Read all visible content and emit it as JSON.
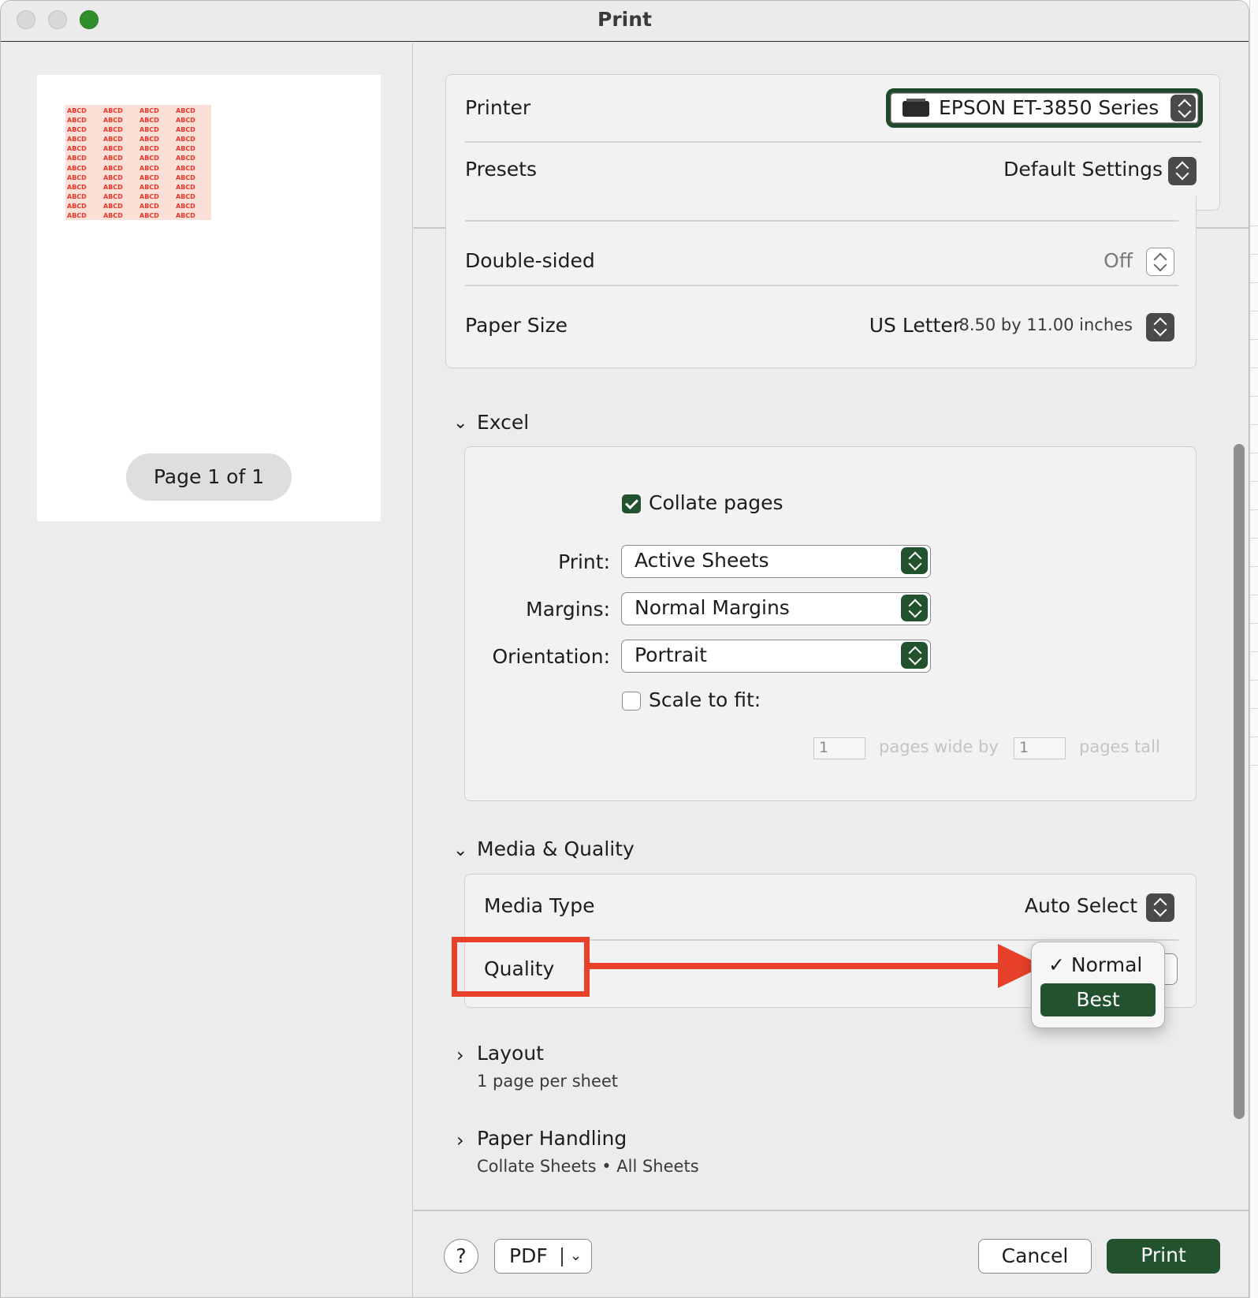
{
  "window": {
    "title": "Print"
  },
  "preview": {
    "thumb_text": "ABCD",
    "page_indicator": "Page 1 of 1"
  },
  "printer": {
    "label": "Printer",
    "value": "EPSON ET-3850 Series",
    "icon": "printer-icon"
  },
  "presets": {
    "label": "Presets",
    "value": "Default Settings"
  },
  "double_sided": {
    "label": "Double-sided",
    "value": "Off"
  },
  "paper_size": {
    "label": "Paper Size",
    "value": "US Letter",
    "dims": "8.50 by 11.00 inches"
  },
  "excel": {
    "header": "Excel",
    "collate_label": "Collate pages",
    "collate_checked": true,
    "print_label": "Print:",
    "print_value": "Active Sheets",
    "margins_label": "Margins:",
    "margins_value": "Normal Margins",
    "orientation_label": "Orientation:",
    "orientation_value": "Portrait",
    "scale_label": "Scale to fit:",
    "scale_checked": false,
    "pages_wide_value": "1",
    "pages_wide_label": "pages wide by",
    "pages_tall_value": "1",
    "pages_tall_label": "pages tall"
  },
  "media_quality": {
    "header": "Media & Quality",
    "media_type_label": "Media Type",
    "media_type_value": "Auto Select",
    "quality_label": "Quality",
    "quality_options": [
      {
        "label": "✓ Normal",
        "selected": true
      },
      {
        "label": "Best",
        "highlighted": true
      }
    ]
  },
  "layout": {
    "header": "Layout",
    "summary": "1 page per sheet"
  },
  "paper_handling": {
    "header": "Paper Handling",
    "summary": "Collate Sheets • All Sheets"
  },
  "buttons": {
    "help": "?",
    "pdf": "PDF",
    "cancel": "Cancel",
    "print": "Print"
  },
  "colors": {
    "accent": "#23522e",
    "annotation": "#e8412b",
    "thumb_text": "#e8362a"
  }
}
